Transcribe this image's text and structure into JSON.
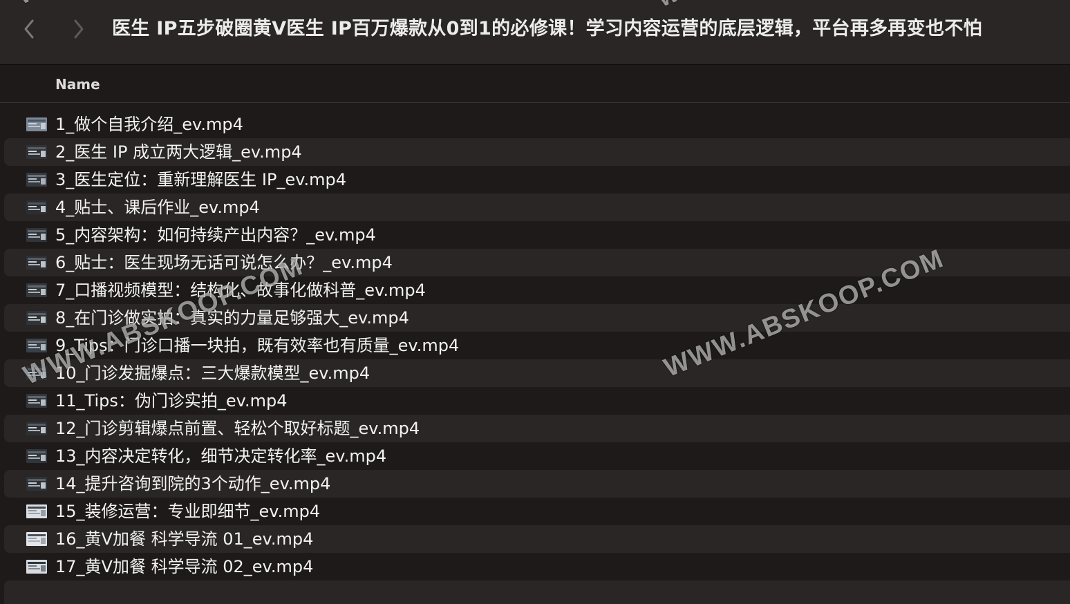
{
  "window": {
    "title": "医生 IP五步破圈黄Ⅴ医生 IP百万爆款从0到1的必修课！学习内容运营的底层逻辑，平台再多再变也不怕"
  },
  "nav": {
    "back_icon": "chevron-left-icon",
    "forward_icon": "chevron-right-icon"
  },
  "columns": {
    "name_label": "Name"
  },
  "files": [
    {
      "name": "1_做个自我介绍_ev.mp4"
    },
    {
      "name": "2_医生 IP 成立两大逻辑_ev.mp4"
    },
    {
      "name": "3_医生定位：重新理解医生 IP_ev.mp4"
    },
    {
      "name": "4_贴士、课后作业_ev.mp4"
    },
    {
      "name": "5_内容架构：如何持续产出内容？_ev.mp4"
    },
    {
      "name": "6_贴士：医生现场无话可说怎么办？_ev.mp4"
    },
    {
      "name": "7_口播视频模型：结构化、故事化做科普_ev.mp4"
    },
    {
      "name": "8_在门诊做实拍：真实的力量足够强大_ev.mp4"
    },
    {
      "name": "9_Tips：门诊口播一块拍，既有效率也有质量_ev.mp4"
    },
    {
      "name": "10_门诊发掘爆点：三大爆款模型_ev.mp4"
    },
    {
      "name": "11_Tips：伪门诊实拍_ev.mp4"
    },
    {
      "name": "12_门诊剪辑爆点前置、轻松个取好标题_ev.mp4"
    },
    {
      "name": "13_内容决定转化，细节决定转化率_ev.mp4"
    },
    {
      "name": "14_提升咨询到院的3个动作_ev.mp4"
    },
    {
      "name": "15_装修运营：专业即细节_ev.mp4"
    },
    {
      "name": "16_黄Ⅴ加餐 科学导流 01_ev.mp4"
    },
    {
      "name": "17_黄Ⅴ加餐 科学导流 02_ev.mp4"
    }
  ],
  "watermark": {
    "text": "WWW.ABSKOOP.COM",
    "top_left": "WW",
    "top_right": "WW"
  },
  "colors": {
    "background": "#1e1a1a",
    "row_alt": "#2a2625",
    "text": "#f2f2f2"
  }
}
